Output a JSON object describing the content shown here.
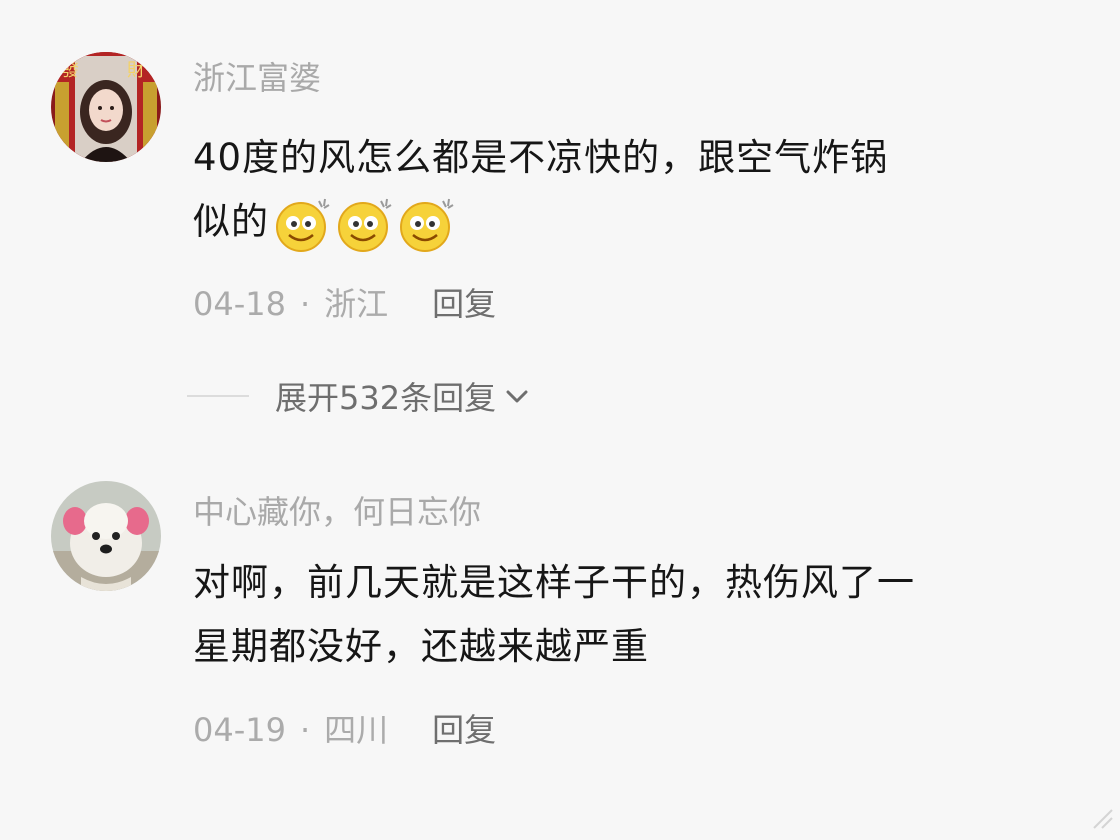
{
  "comments": [
    {
      "username": "浙江富婆",
      "text_line1": "40度的风怎么都是不凉快的，跟空气炸锅",
      "text_line2": "似的",
      "emoji": [
        "dizzy-smile-emoji",
        "dizzy-smile-emoji",
        "dizzy-smile-emoji"
      ],
      "date": "04-18",
      "location": "浙江",
      "reply_label": "回复",
      "avatar": "woman-portrait-avatar",
      "avatar_text": [
        "發",
        "財"
      ]
    },
    {
      "username": "中心藏你，何日忘你",
      "text_line1": "对啊，前几天就是这样子干的，热伤风了一",
      "text_line2": "星期都没好，还越来越严重",
      "date": "04-19",
      "location": "四川",
      "reply_label": "回复",
      "avatar": "white-dog-avatar"
    }
  ],
  "expand_replies": {
    "label": "展开532条回复",
    "icon": "chevron-down-icon"
  },
  "separator": "·",
  "colors": {
    "background": "#f7f7f7",
    "username": "#a9a9a9",
    "text": "#161616",
    "meta": "#ababab",
    "reply": "#6f6f6f"
  }
}
